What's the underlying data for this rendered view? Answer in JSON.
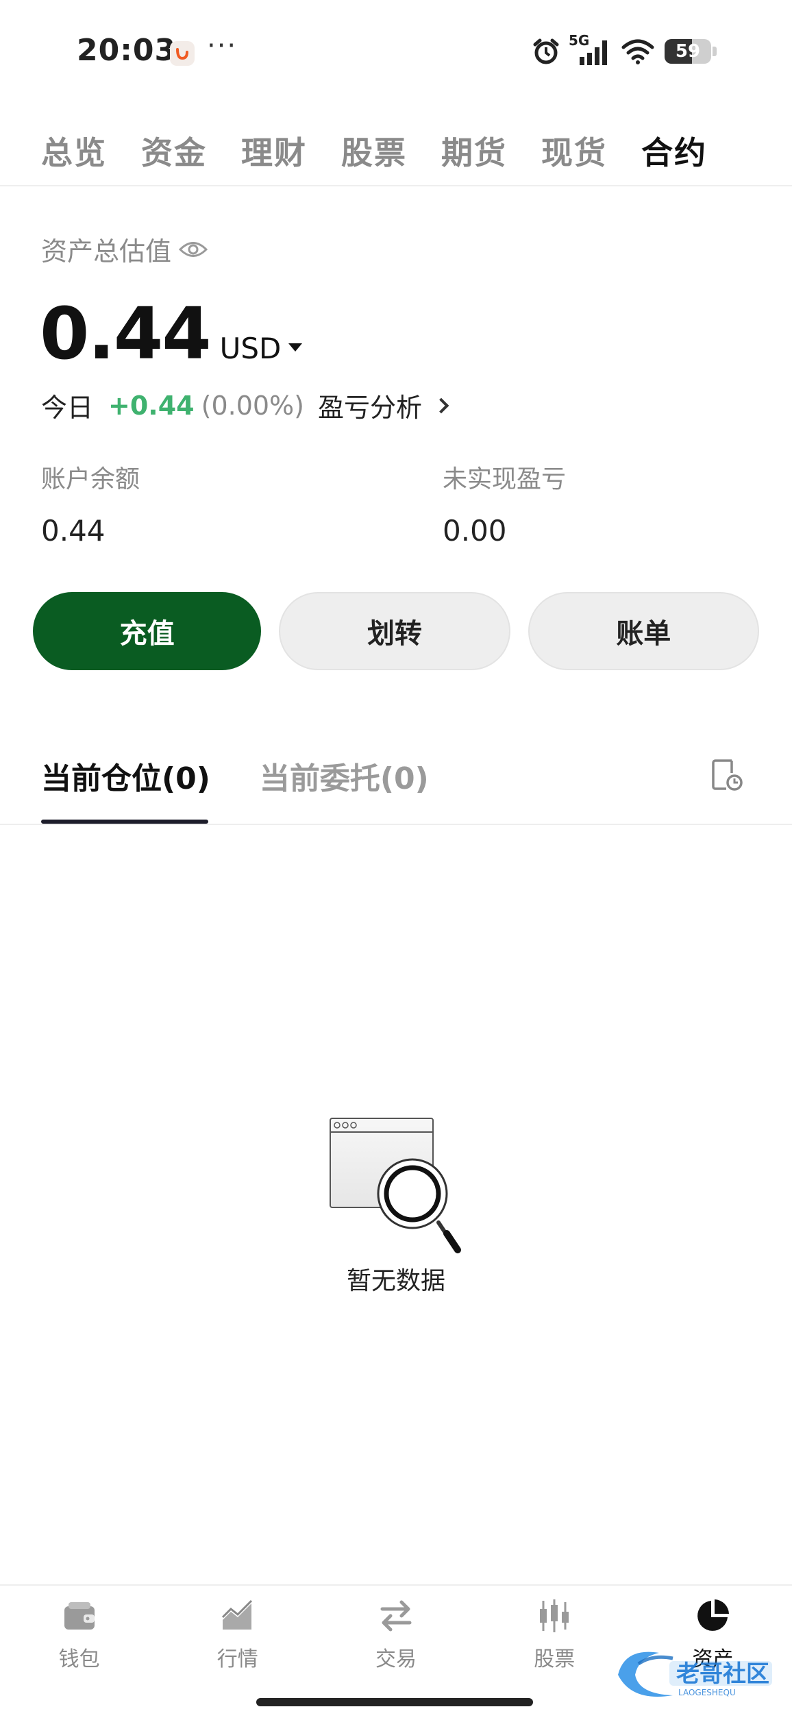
{
  "status_bar": {
    "time": "20:03",
    "app_icon": "orange-app-badge-icon",
    "more_dots": "···",
    "network": "5G",
    "battery_level": "59",
    "icons": [
      "alarm-icon",
      "signal-icon",
      "wifi-icon",
      "battery-icon"
    ]
  },
  "top_tabs": [
    {
      "label": "总览",
      "active": false
    },
    {
      "label": "资金",
      "active": false
    },
    {
      "label": "理财",
      "active": false
    },
    {
      "label": "股票",
      "active": false
    },
    {
      "label": "期货",
      "active": false
    },
    {
      "label": "现货",
      "active": false
    },
    {
      "label": "合约",
      "active": true
    }
  ],
  "asset": {
    "label": "资产总估值",
    "value": "0.44",
    "currency": "USD",
    "today_label": "今日",
    "today_change": "+0.44",
    "today_pct": "(0.00%)",
    "analysis_link": "盈亏分析",
    "balance_label": "账户余额",
    "balance_value": "0.44",
    "unrealized_label": "未实现盈亏",
    "unrealized_value": "0.00"
  },
  "actions": {
    "deposit": "充值",
    "transfer": "划转",
    "bill": "账单"
  },
  "position_tabs": {
    "positions": "当前仓位(0)",
    "orders": "当前委托(0)"
  },
  "empty_state": {
    "text": "暂无数据"
  },
  "bottom_nav": [
    {
      "label": "钱包",
      "icon": "wallet-icon"
    },
    {
      "label": "行情",
      "icon": "market-chart-icon"
    },
    {
      "label": "交易",
      "icon": "swap-arrows-icon"
    },
    {
      "label": "股票",
      "icon": "candlestick-icon"
    },
    {
      "label": "资产",
      "icon": "pie-chart-icon",
      "active": true
    }
  ],
  "colors": {
    "primary_green": "#0a5c22",
    "gain_green": "#3fb26f",
    "muted": "#8a8a8a"
  }
}
